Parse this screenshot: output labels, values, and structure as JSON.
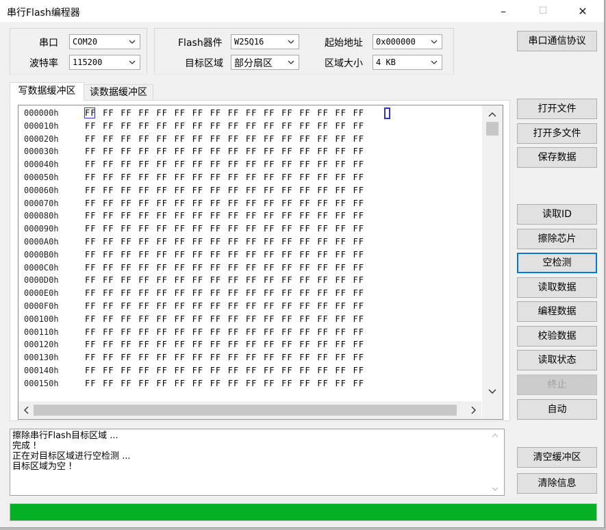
{
  "window": {
    "title": "串行Flash编程器",
    "minimize_glyph": "–",
    "maximize_glyph": "☐",
    "close_glyph": "✕"
  },
  "serial": {
    "port_label": "串口",
    "port_value": "COM20",
    "baud_label": "波特率",
    "baud_value": "115200"
  },
  "flash": {
    "device_label": "Flash器件",
    "device_value": "W25Q16",
    "target_label": "目标区域",
    "target_value": "部分扇区",
    "start_label": "起始地址",
    "start_value": "0x000000",
    "size_label": "区域大小",
    "size_value": "4 KB"
  },
  "protocol_button": "串口通信协议",
  "tabs": [
    {
      "label": "写数据缓冲区",
      "active": true
    },
    {
      "label": "读数据缓冲区",
      "active": false
    }
  ],
  "hex": {
    "addresses": [
      "000000h",
      "000010h",
      "000020h",
      "000030h",
      "000040h",
      "000050h",
      "000060h",
      "000070h",
      "000080h",
      "000090h",
      "0000A0h",
      "0000B0h",
      "0000C0h",
      "0000D0h",
      "0000E0h",
      "0000F0h",
      "000100h",
      "000110h",
      "000120h",
      "000130h",
      "000140h",
      "000150h"
    ],
    "byte_value": "FF",
    "bytes_per_row": 16
  },
  "buttons": {
    "open_file": "打开文件",
    "open_multi": "打开多文件",
    "save_data": "保存数据",
    "read_id": "读取ID",
    "erase_chip": "擦除芯片",
    "blank_check": "空检测",
    "read_data": "读取数据",
    "program_data": "编程数据",
    "verify_data": "校验数据",
    "read_status": "读取状态",
    "stop": "终止",
    "auto": "自动",
    "clear_buffer": "清空缓冲区",
    "clear_info": "清除信息"
  },
  "log": [
    "擦除串行Flash目标区域 ...",
    "完成 !",
    "正在对目标区域进行空检测 ...",
    "目标区域为空 !"
  ],
  "progress": {
    "percent": 100,
    "color": "#06b025"
  },
  "accent_color": "#0078d7"
}
